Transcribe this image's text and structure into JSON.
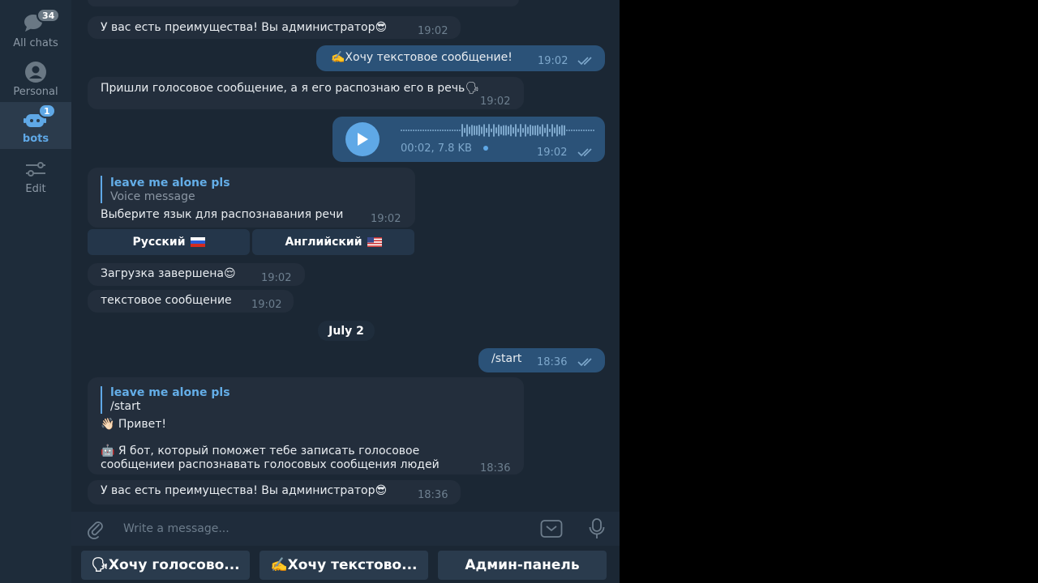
{
  "folders": [
    {
      "label": "All chats",
      "badge": "34",
      "icon": "chats-icon"
    },
    {
      "label": "Personal",
      "badge": "",
      "icon": "person-icon"
    },
    {
      "label": "bots",
      "badge": "1",
      "icon": "bot-icon"
    },
    {
      "label": "Edit",
      "badge": "",
      "icon": "sliders-icon"
    }
  ],
  "messages": {
    "m1": {
      "text": "У вас есть преимущества! Вы администратор😎",
      "time": "19:02"
    },
    "m2": {
      "text": "✍️Хочу текстовое сообщение!",
      "time": "19:02"
    },
    "m3": {
      "text": "Пришли голосовое сообщение, а я его распознаю его в речь🗣",
      "time": "19:02"
    },
    "m4": {
      "meta": "00:02, 7.8 KB",
      "time": "19:02"
    },
    "m5": {
      "reply_name": "leave me alone pls",
      "reply_text": "Voice message",
      "text": "Выберите язык для распознавания речи",
      "time": "19:02",
      "buttons": [
        "Русский",
        "Английский"
      ]
    },
    "m6": {
      "text": "Загрузка завершена😌",
      "time": "19:02"
    },
    "m7": {
      "text": "текстовое сообщение",
      "time": "19:02"
    },
    "date": "July 2",
    "m8": {
      "text": "/start",
      "time": "18:36"
    },
    "m9": {
      "reply_name": "leave me alone pls",
      "reply_text": "/start",
      "line1": "👋🏻 Привет!",
      "line2": "🤖 Я бот, который поможет тебе записать голосовое",
      "line3": "сообщениеи распознавать голосовых сообщения людей",
      "time": "18:36"
    },
    "m10": {
      "text": "У вас есть преимущества! Вы администратор😎",
      "time": "18:36"
    }
  },
  "composer": {
    "placeholder": "Write a message..."
  },
  "bot_keyboard": [
    "🗣Хочу голосово...",
    "✍️Хочу текстово...",
    "Админ-панель"
  ],
  "colors": {
    "accent": "#5fa8e6",
    "incoming": "#232e3c",
    "outgoing": "#2b5278",
    "background": "#1b2734"
  }
}
